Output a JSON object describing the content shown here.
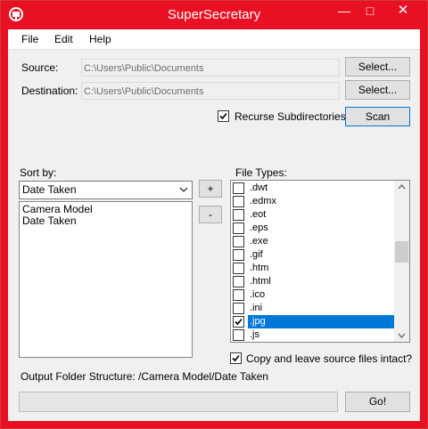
{
  "window": {
    "title": "SuperSecretary",
    "minimize": "—",
    "maximize": "□",
    "close": "✕"
  },
  "menu": {
    "file": "File",
    "edit": "Edit",
    "help": "Help"
  },
  "source": {
    "label": "Source:",
    "value": "C:\\Users\\Public\\Documents",
    "button": "Select..."
  },
  "destination": {
    "label": "Destination:",
    "value": "C:\\Users\\Public\\Documents",
    "button": "Select..."
  },
  "recurse": {
    "label": "Recurse Subdirectories",
    "checked": true
  },
  "scan_button": "Scan",
  "sort": {
    "label": "Sort by:",
    "selected": "Date Taken",
    "add": "+",
    "remove": "-",
    "items": [
      "Camera Model",
      "Date Taken"
    ]
  },
  "file_types": {
    "label": "File Types:",
    "items": [
      {
        "label": ".dwt",
        "checked": false,
        "selected": false
      },
      {
        "label": ".edmx",
        "checked": false,
        "selected": false
      },
      {
        "label": ".eot",
        "checked": false,
        "selected": false
      },
      {
        "label": ".eps",
        "checked": false,
        "selected": false
      },
      {
        "label": ".exe",
        "checked": false,
        "selected": false
      },
      {
        "label": ".gif",
        "checked": false,
        "selected": false
      },
      {
        "label": ".htm",
        "checked": false,
        "selected": false
      },
      {
        "label": ".html",
        "checked": false,
        "selected": false
      },
      {
        "label": ".ico",
        "checked": false,
        "selected": false
      },
      {
        "label": ".ini",
        "checked": false,
        "selected": false
      },
      {
        "label": ".jpg",
        "checked": true,
        "selected": true
      },
      {
        "label": ".js",
        "checked": false,
        "selected": false
      }
    ],
    "scroll_position": 0.42
  },
  "copy": {
    "label": "Copy and leave source files intact?",
    "checked": true
  },
  "output_structure": "Output Folder Structure: /Camera Model/Date Taken",
  "progress": 0,
  "go_button": "Go!"
}
